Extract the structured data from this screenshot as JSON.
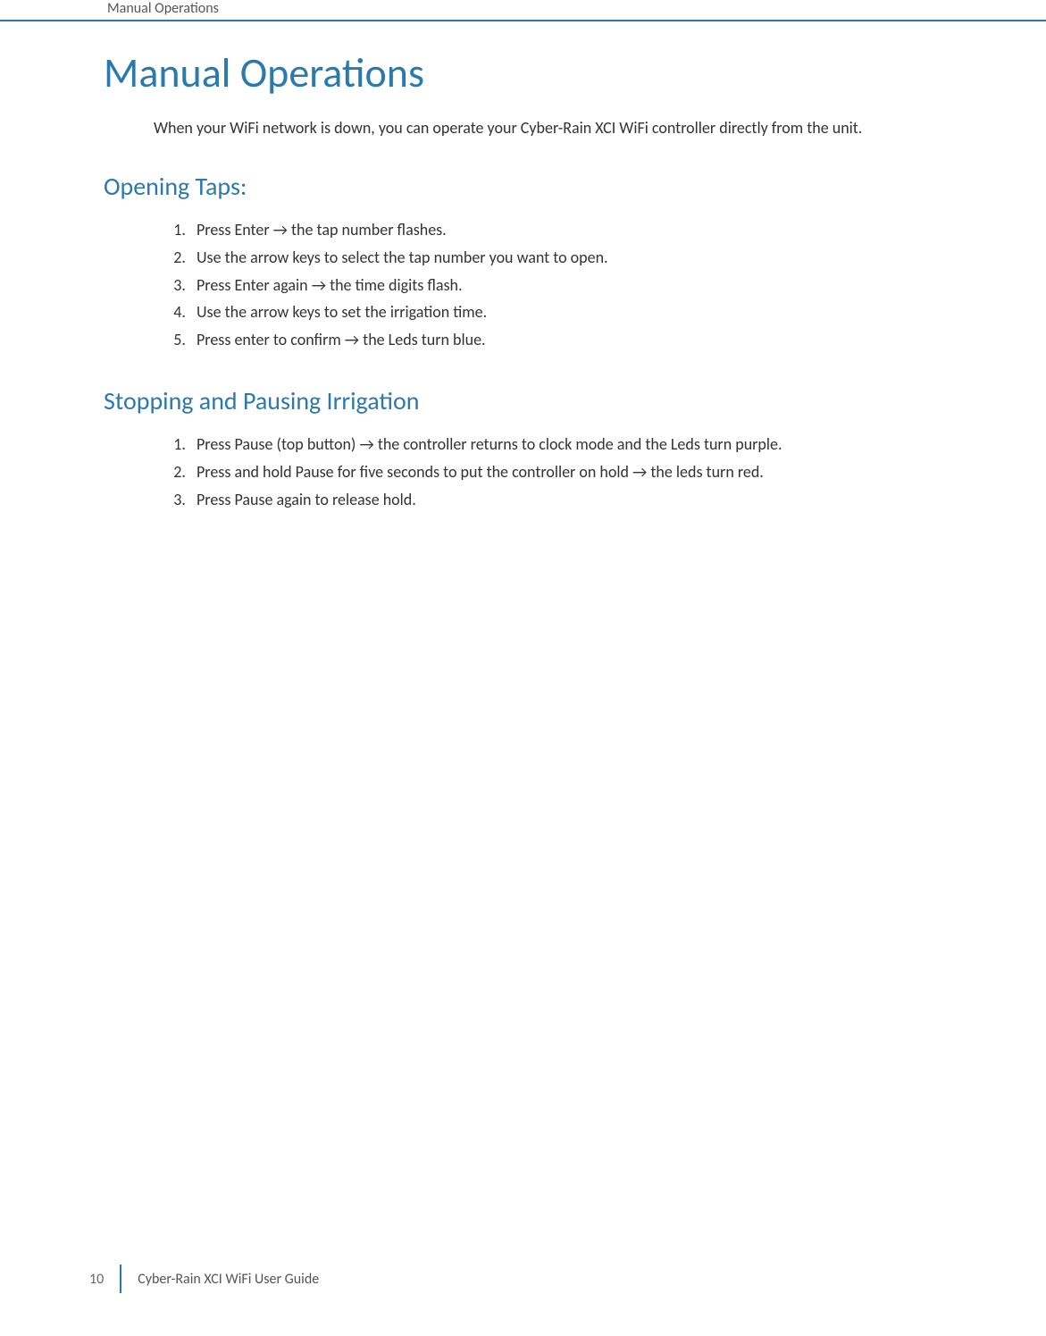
{
  "header": {
    "running_title": "Manual Operations"
  },
  "page": {
    "title": "Manual Operations",
    "intro": "When your WiFi network is down, you can operate your Cyber-Rain XCI WiFi controller directly from the unit."
  },
  "sections": [
    {
      "heading": "Opening Taps:",
      "items": [
        "Press Enter → the tap number flashes.",
        "Use the arrow keys to select the tap number you want to open.",
        "Press Enter again → the time digits flash.",
        "Use the arrow keys to set the irrigation time.",
        "Press enter to confirm → the Leds turn blue."
      ]
    },
    {
      "heading": "Stopping and Pausing Irrigation",
      "items": [
        "Press Pause (top button) → the controller returns to clock mode and the Leds turn purple.",
        "Press and hold Pause for five seconds to put the controller on hold → the leds turn red.",
        "Press Pause again to release hold."
      ]
    }
  ],
  "footer": {
    "page_number": "10",
    "guide_title": "Cyber-Rain XCI WiFi User Guide"
  }
}
